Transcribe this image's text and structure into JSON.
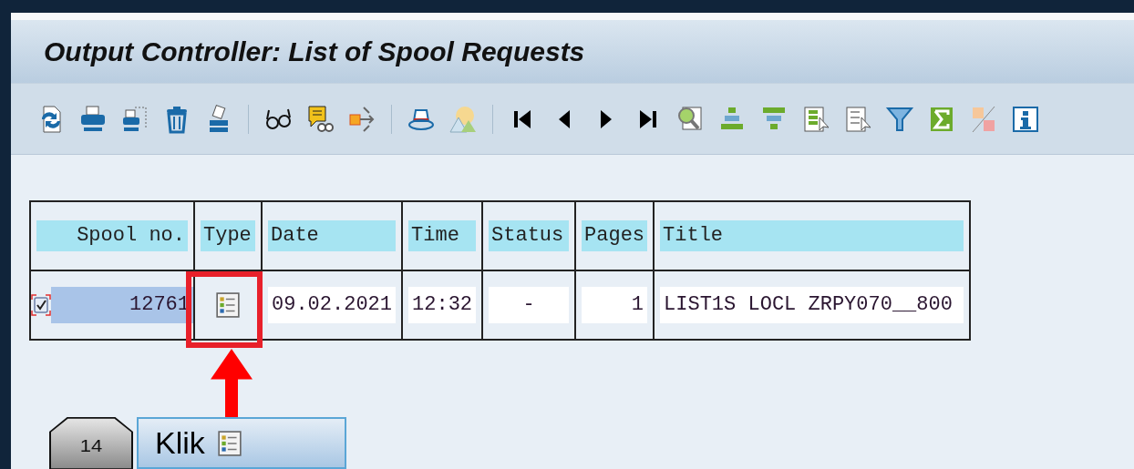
{
  "window": {
    "title": "Output Controller: List of Spool Requests"
  },
  "table": {
    "columns": [
      {
        "label": "Spool no."
      },
      {
        "label": "Type"
      },
      {
        "label": "Date"
      },
      {
        "label": "Time"
      },
      {
        "label": "Status"
      },
      {
        "label": "Pages"
      },
      {
        "label": "Title"
      }
    ],
    "rows": [
      {
        "checked": true,
        "selected": true,
        "spool_no": "12761",
        "date": "09.02.2021",
        "time": "12:32",
        "status": "-",
        "pages": "1",
        "title": "LIST1S LOCL ZRPY070__800"
      }
    ]
  },
  "callout": {
    "step": "14",
    "text": "Klik"
  }
}
